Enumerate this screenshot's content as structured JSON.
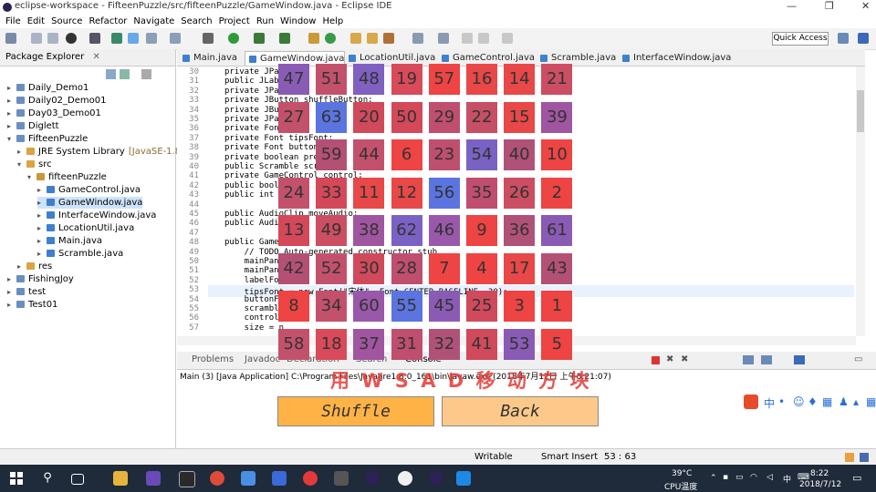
{
  "window": {
    "title": "eclipse-workspace - FifteenPuzzle/src/fifteenPuzzle/GameWindow.java - Eclipse IDE",
    "controls": [
      "—",
      "❐",
      "✕"
    ]
  },
  "menu": [
    "File",
    "Edit",
    "Source",
    "Refactor",
    "Navigate",
    "Search",
    "Project",
    "Run",
    "Window",
    "Help"
  ],
  "toolbar": {
    "quick_access": "Quick Access"
  },
  "explorer": {
    "title": "Package Explorer",
    "tree": [
      {
        "label": "Daily_Demo1",
        "indent": 0,
        "kind": "proj",
        "arrow": "▸"
      },
      {
        "label": "Daily02_Demo01",
        "indent": 0,
        "kind": "proj",
        "arrow": "▸"
      },
      {
        "label": "Day03_Demo01",
        "indent": 0,
        "kind": "proj",
        "arrow": "▸"
      },
      {
        "label": "Diglett",
        "indent": 0,
        "kind": "proj",
        "arrow": "▸"
      },
      {
        "label": "FifteenPuzzle",
        "indent": 0,
        "kind": "proj",
        "arrow": "▾"
      },
      {
        "label": "JRE System Library",
        "suffix": "[JavaSE-1.8]",
        "indent": 1,
        "kind": "fold",
        "arrow": "▸"
      },
      {
        "label": "src",
        "indent": 1,
        "kind": "fold",
        "arrow": "▾"
      },
      {
        "label": "fifteenPuzzle",
        "indent": 2,
        "kind": "pkg",
        "arrow": "▾"
      },
      {
        "label": "GameControl.java",
        "indent": 3,
        "kind": "jav",
        "arrow": "▸"
      },
      {
        "label": "GameWindow.java",
        "indent": 3,
        "kind": "jav",
        "arrow": "▸",
        "selected": true
      },
      {
        "label": "InterfaceWindow.java",
        "indent": 3,
        "kind": "jav",
        "arrow": "▸"
      },
      {
        "label": "LocationUtil.java",
        "indent": 3,
        "kind": "jav",
        "arrow": "▸"
      },
      {
        "label": "Main.java",
        "indent": 3,
        "kind": "jav",
        "arrow": "▸"
      },
      {
        "label": "Scramble.java",
        "indent": 3,
        "kind": "jav",
        "arrow": "▸"
      },
      {
        "label": "res",
        "indent": 1,
        "kind": "fold",
        "arrow": "▸"
      },
      {
        "label": "FishingJoy",
        "indent": 0,
        "kind": "proj",
        "arrow": "▸"
      },
      {
        "label": "test",
        "indent": 0,
        "kind": "proj",
        "arrow": "▸"
      },
      {
        "label": "Test01",
        "indent": 0,
        "kind": "proj",
        "arrow": "▸"
      }
    ]
  },
  "editor": {
    "tabs": [
      {
        "label": "Main.java",
        "active": false
      },
      {
        "label": "GameWindow.java",
        "active": true
      },
      {
        "label": "LocationUtil.java",
        "active": false
      },
      {
        "label": "GameControl.java",
        "active": false
      },
      {
        "label": "Scramble.java",
        "active": false
      },
      {
        "label": "InterfaceWindow.java",
        "active": false
      }
    ],
    "lines": [
      {
        "n": "30",
        "text": "private JPan"
      },
      {
        "n": "31",
        "text": "public JLabe"
      },
      {
        "n": "32",
        "text": "private JPan"
      },
      {
        "n": "33",
        "text": "private JButton shuffleButton;"
      },
      {
        "n": "34",
        "text": "private JBut"
      },
      {
        "n": "35",
        "text": "private JPan"
      },
      {
        "n": "36",
        "text": "private Font"
      },
      {
        "n": "37",
        "text": "private Font tipsFont;"
      },
      {
        "n": "38",
        "text": "private Font buttonFo"
      },
      {
        "n": "39",
        "text": "private boolean press"
      },
      {
        "n": "40",
        "text": "public Scramble scram"
      },
      {
        "n": "41",
        "text": "private GameControl control;"
      },
      {
        "n": "42",
        "text": "public boole"
      },
      {
        "n": "43",
        "text": "public int s"
      },
      {
        "n": "44",
        "text": ""
      },
      {
        "n": "45",
        "text": "public AudioClip moveAudio;"
      },
      {
        "n": "46",
        "text": "public Audio"
      },
      {
        "n": "47",
        "text": ""
      },
      {
        "n": "48",
        "text": "public GameW"
      },
      {
        "n": "49",
        "text": "    // TODO Auto-generated constructor stub"
      },
      {
        "n": "50",
        "text": "    mainPane"
      },
      {
        "n": "51",
        "text": "    mainPane"
      },
      {
        "n": "52",
        "text": "    labelFon"
      },
      {
        "n": "53",
        "text": "    tipsFont = new Font(\"宋体\", Font.CENTER_BASELINE, 30);"
      },
      {
        "n": "54",
        "text": "    buttonFo"
      },
      {
        "n": "55",
        "text": "    scramble"
      },
      {
        "n": "56",
        "text": "    control"
      },
      {
        "n": "57",
        "text": "    size = n"
      }
    ]
  },
  "bottom": {
    "tabs": [
      "Problems",
      "Javadoc",
      "Declaration",
      "Search",
      "Console"
    ],
    "console_line": "Main (3) [Java Application] C:\\Program Files\\Java\\jre1.8.0_161\\bin\\javaw.exe (2018年7月12日 上午8:21:07)"
  },
  "statusbar": {
    "mode": "Writable",
    "insert": "Smart Insert",
    "position": "53 : 63"
  },
  "taskbar": {
    "weather": "39°C",
    "cpu": "CPU温度",
    "time": "8:22",
    "date": "2018/7/12",
    "ime_lang": "中",
    "ime_text": "英"
  },
  "watermark": "用 W S A D 移 动 方 块",
  "game": {
    "tiles": [
      [
        47,
        51,
        48,
        19,
        57,
        16,
        14,
        21
      ],
      [
        27,
        63,
        20,
        50,
        29,
        22,
        15,
        39
      ],
      [
        null,
        59,
        44,
        6,
        23,
        54,
        40,
        10
      ],
      [
        24,
        33,
        11,
        12,
        56,
        35,
        26,
        2
      ],
      [
        13,
        49,
        38,
        62,
        46,
        9,
        36,
        61
      ],
      [
        42,
        52,
        30,
        28,
        7,
        4,
        17,
        43
      ],
      [
        8,
        34,
        60,
        55,
        45,
        25,
        3,
        1
      ],
      [
        58,
        18,
        37,
        31,
        32,
        41,
        53,
        5
      ]
    ],
    "colors": {
      "47": "#8a5bb5",
      "51": "#c4516c",
      "48": "#8060c0",
      "19": "#d94a5a",
      "57": "#ee4444",
      "16": "#e84848",
      "14": "#e84848",
      "21": "#cc4e62",
      "27": "#c4516c",
      "63": "#5b74e0",
      "20": "#d04a5c",
      "50": "#d4485a",
      "29": "#c04e6e",
      "22": "#c64f66",
      "15": "#e84848",
      "39": "#a055a0",
      "59": "#b45074",
      "44": "#c4516c",
      "6": "#ee4444",
      "23": "#c04e6e",
      "54": "#7a62c4",
      "40": "#b05278",
      "10": "#ee4444",
      "24": "#c4516c",
      "33": "#d4485a",
      "11": "#e84848",
      "12": "#e84848",
      "56": "#5b74e0",
      "35": "#c04e6e",
      "26": "#cc4e62",
      "2": "#ee4444",
      "13": "#d4485a",
      "49": "#cc4e62",
      "38": "#a055a0",
      "62": "#7a62c4",
      "46": "#9a58aa",
      "9": "#ee4444",
      "36": "#b05278",
      "61": "#8a5bb5",
      "42": "#b45074",
      "52": "#c4516c",
      "30": "#d04a5c",
      "28": "#c04e6e",
      "7": "#ee4444",
      "4": "#ee4444",
      "17": "#e84848",
      "43": "#b45074",
      "8": "#ee4444",
      "34": "#c4516c",
      "60": "#9a58aa",
      "55": "#5b74e0",
      "45": "#8a5bb5",
      "25": "#d04a5c",
      "3": "#ee4444",
      "1": "#ee4444",
      "58": "#c4516c",
      "18": "#d94a5a",
      "37": "#a055a0",
      "31": "#c04e6e",
      "32": "#b05278",
      "41": "#d04a5c",
      "53": "#8a5bb5",
      "5": "#ee4444"
    },
    "shuffle_label": "Shuffle",
    "back_label": "Back",
    "shuffle_color": "#ffb347",
    "back_color": "#fcc98a"
  }
}
